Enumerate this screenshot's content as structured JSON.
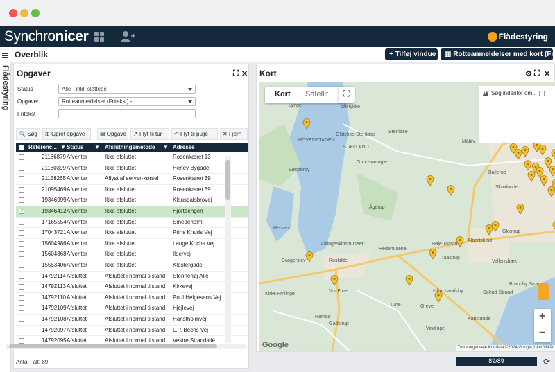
{
  "app": {
    "brand_prefix": "Synchro",
    "brand_suffix": "nicer",
    "module_label": "Flådestyring",
    "page_title": "Overblik",
    "side_tab_label": "Flådestyring",
    "add_window_label": "Tilføj vindue",
    "view_select_label": "Rotteanmeldelser med kort (Fritekst)"
  },
  "tasks_panel": {
    "title": "Opgaver",
    "filters": {
      "status_label": "Status",
      "status_value": "Alle - inkl. slettede",
      "tasks_label": "Opgaver",
      "tasks_value": "Rotteanmeldelser (Fritekst) -",
      "freetext_label": "Fritekst",
      "freetext_value": ""
    },
    "toolbar": {
      "search": "Søg",
      "create": "Opret opgave",
      "task": "Opgave",
      "move_to_trip": "Flyt til tur",
      "move_to_pool": "Flyt til pulje",
      "remove": "Fjern"
    },
    "columns": [
      "Referenc...",
      "Status",
      "Afslutningsmetode",
      "Adresse"
    ],
    "rows": [
      {
        "ref": "21166879",
        "status": "Afventer",
        "method": "Ikke afsluttet",
        "address": "Rosenkæret 13",
        "selected": false
      },
      {
        "ref": "21160399",
        "status": "Afventer",
        "method": "Ikke afsluttet",
        "address": "Herlev Bygade",
        "selected": false
      },
      {
        "ref": "21158265",
        "status": "Afventer",
        "method": "Aflyst af server-kørsel",
        "address": "Rosenkæret 39",
        "selected": false
      },
      {
        "ref": "21095469",
        "status": "Afventer",
        "method": "Ikke afsluttet",
        "address": "Rosenkæret 39",
        "selected": false
      },
      {
        "ref": "19346999",
        "status": "Afventer",
        "method": "Ikke afsluttet",
        "address": "Klausdalsbrovej",
        "selected": false
      },
      {
        "ref": "19346412",
        "status": "Afventer",
        "method": "Ikke afsluttet",
        "address": "Hjorteengen",
        "selected": true
      },
      {
        "ref": "17165554",
        "status": "Afventer",
        "method": "Ikke afsluttet",
        "address": "Smedeholm",
        "selected": false
      },
      {
        "ref": "17043721",
        "status": "Afventer",
        "method": "Ikke afsluttet",
        "address": "Prins Knuds Vej",
        "selected": false
      },
      {
        "ref": "15604986",
        "status": "Afventer",
        "method": "Ikke afsluttet",
        "address": "Lauge Kochs Vej",
        "selected": false
      },
      {
        "ref": "15604868",
        "status": "Afventer",
        "method": "Ikke afsluttet",
        "address": "Ildervej",
        "selected": false
      },
      {
        "ref": "15553406",
        "status": "Afventer",
        "method": "Ikke afsluttet",
        "address": "Klostergade",
        "selected": false
      },
      {
        "ref": "14792114",
        "status": "Afsluttet",
        "method": "Afsluttet i normal tilstand",
        "address": "Stennehøj Allé",
        "selected": false
      },
      {
        "ref": "14792113",
        "status": "Afsluttet",
        "method": "Afsluttet i normal tilstand",
        "address": "Kirkevej",
        "selected": false
      },
      {
        "ref": "14792110",
        "status": "Afsluttet",
        "method": "Afsluttet i normal tilstand",
        "address": "Poul Helgesens Vej",
        "selected": false
      },
      {
        "ref": "14792109",
        "status": "Afsluttet",
        "method": "Afsluttet i normal tilstand",
        "address": "Hjejlevej",
        "selected": false
      },
      {
        "ref": "14792108",
        "status": "Afsluttet",
        "method": "Afsluttet i normal tilstand",
        "address": "Hanstholmvej",
        "selected": false
      },
      {
        "ref": "14792097",
        "status": "Afsluttet",
        "method": "Afsluttet i normal tilstand",
        "address": "L.P. Bechs Vej",
        "selected": false
      },
      {
        "ref": "14792095",
        "status": "Afsluttet",
        "method": "Afsluttet i normal tilstand",
        "address": "Vestre Strandallé",
        "selected": false
      }
    ],
    "total_label": "Antal i alt: 89"
  },
  "map_panel": {
    "title": "Kort",
    "tab_map": "Kort",
    "tab_satellite": "Satellit",
    "search_area_label": "Søg indenfor om...",
    "attribution": "Tastaturgenveje   Kortdata ©2024 Google   1 km   Vilkår",
    "google_logo": "Google",
    "zoom_in": "+",
    "zoom_out": "−",
    "place_labels": [
      "Lynge",
      "Ølstykke",
      "Stenløse",
      "Måløv",
      "Ballerup",
      "Skovlunde",
      "Gundsømagle",
      "Sønderby",
      "Ågerup",
      "Glostrup",
      "Albertslund",
      "Høje Taastrup",
      "Taastrup",
      "Vallensbæk",
      "Hedehusene",
      "Roskilde",
      "Vor Frue",
      "Svogerslev",
      "Greve",
      "Solrød Strand",
      "Gadstrup",
      "Karlslunde",
      "Tune",
      "Kirke Hyllinge",
      "Vikingeskibsmuseet",
      "Brøndby Strand",
      "Ishøj Landsby",
      "Herslev",
      "Ramsø",
      "Vindinge",
      "HOVEDSTADEN",
      "SJÆLLAND",
      "Olstykke-Stenløse"
    ]
  },
  "footer": {
    "counter": "89/89"
  }
}
